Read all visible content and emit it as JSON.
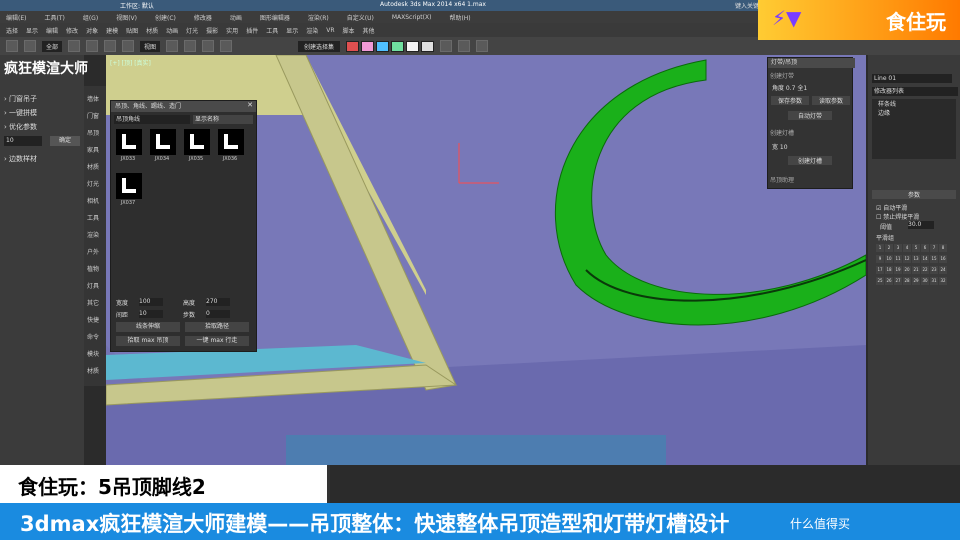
{
  "brand": {
    "logo_text": "食住玩",
    "panel_title": "疯狂模渲大师"
  },
  "titlebar": {
    "workspace": "工作区: 默认",
    "app_title": "Autodesk 3ds Max 2014 x64     1.max",
    "search_placeholder": "键入关键字"
  },
  "menu": [
    "编辑(E)",
    "工具(T)",
    "组(G)",
    "视图(V)",
    "创建(C)",
    "修改器",
    "动画",
    "图形编辑器",
    "渲染(R)",
    "自定义(U)",
    "MAXScript(X)",
    "帮助(H)"
  ],
  "toolbar1": [
    "选择",
    "显示",
    "编辑",
    "修改",
    "对象",
    "建模",
    "贴图",
    "材质",
    "动画",
    "灯光",
    "摄影",
    "实用",
    "插件",
    "工具",
    "显示",
    "渲染",
    "VR",
    "脚本",
    "其他"
  ],
  "toolbar2": {
    "view_dropdown": "全部",
    "coord_dropdown": "视图",
    "selection_set": "创建选择集",
    "swatches": [
      "#e05050",
      "#f29ad6",
      "#50c0ff",
      "#70e0a0",
      "#f5f5f5",
      "#e0e0e0"
    ]
  },
  "left_panel": {
    "items": [
      {
        "label": "门窗吊子"
      },
      {
        "label": "一键拼模"
      },
      {
        "label": "优化参数"
      }
    ],
    "spinner_value": "10",
    "confirm_label": "确定",
    "edge_label": "边数样材"
  },
  "side_col": [
    "墙体",
    "门窗",
    "吊顶",
    "家具",
    "材质",
    "灯光",
    "相机",
    "工具",
    "渲染",
    "户外",
    "植物",
    "灯具",
    "其它",
    "快捷",
    "命令",
    "模块",
    "材质"
  ],
  "viewport": {
    "label": "[+] [顶] [真实]"
  },
  "lib_window": {
    "title": "吊顶、角线、踢线、造门",
    "dropdown": "吊顶角线",
    "tab2": "显示名称",
    "thumbs": [
      "JX033",
      "JX034",
      "JX035",
      "JX036",
      "JX037"
    ],
    "labels": {
      "width": "宽度",
      "width_val": "100",
      "height": "高度",
      "height_val": "270",
      "dist": "间距",
      "dist_val": "10",
      "step": "步数",
      "step_val": "0"
    },
    "btn_stretch": "线条伸缩",
    "btn_pick": "拾取路径",
    "btn_out": "拾取 max 吊顶",
    "btn_in": "一键 max 行走"
  },
  "light_window": {
    "title": "灯带/吊顶",
    "section1": "创建灯带",
    "field1": "角度 0.7 全1",
    "btn1": "保存参数",
    "btn2": "读取参数",
    "btn3": "自动灯带",
    "section2": "创建灯槽",
    "field2": "宽 10",
    "btn4": "创建灯槽",
    "section3": "吊顶助理"
  },
  "right_panel": {
    "name_field": "Line 01",
    "list_label": "修改器列表",
    "stack": [
      "样条线",
      "边缘"
    ],
    "section": "参数",
    "opt1": "自动平滑",
    "opt2": "禁止焊接平滑",
    "threshold_label": "阈值",
    "threshold_val": "30.0",
    "grid_label": "平滑组"
  },
  "captions": {
    "line1": "食住玩：5吊顶脚线2",
    "line2": "3dmax疯狂模渲大师建模——吊顶整体：快速整体吊顶造型和灯带灯槽设计"
  },
  "watermark": "什么值得买"
}
